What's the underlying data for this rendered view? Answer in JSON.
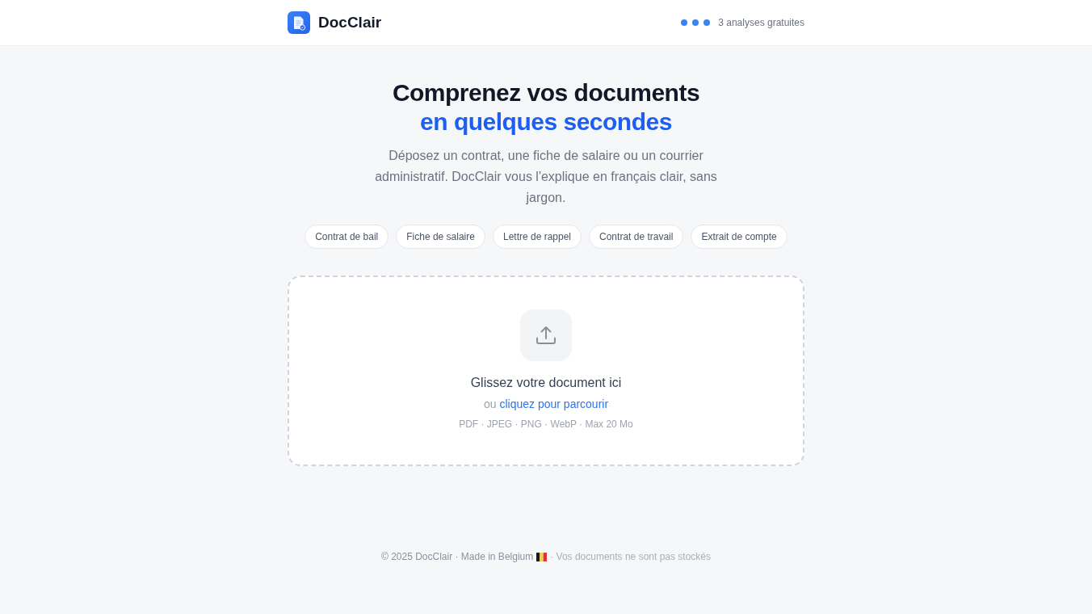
{
  "header": {
    "brand": "DocClair",
    "credits": {
      "dots": [
        {
          "filled": true
        },
        {
          "filled": true
        },
        {
          "filled": true
        }
      ],
      "label": "3 analyses gratuites"
    }
  },
  "hero": {
    "title": "Comprenez vos documents",
    "title_highlight": "en quelques secondes",
    "subtitle": "Déposez un contrat, une fiche de salaire ou un courrier administratif. DocClair vous l'explique en français clair, sans jargon."
  },
  "examples": [
    "Contrat de bail",
    "Fiche de salaire",
    "Lettre de rappel",
    "Contrat de travail",
    "Extrait de compte"
  ],
  "upload": {
    "prompt": "Glissez votre document ici",
    "alternative": "ou",
    "link": "cliquez pour parcourir",
    "formats": "PDF · JPEG · PNG · WebP · Max 20 Mo"
  },
  "footer": {
    "copyright": "© 2025 DocClair · Made in Belgium",
    "note": "· Vos documents ne sont pas stockés"
  }
}
